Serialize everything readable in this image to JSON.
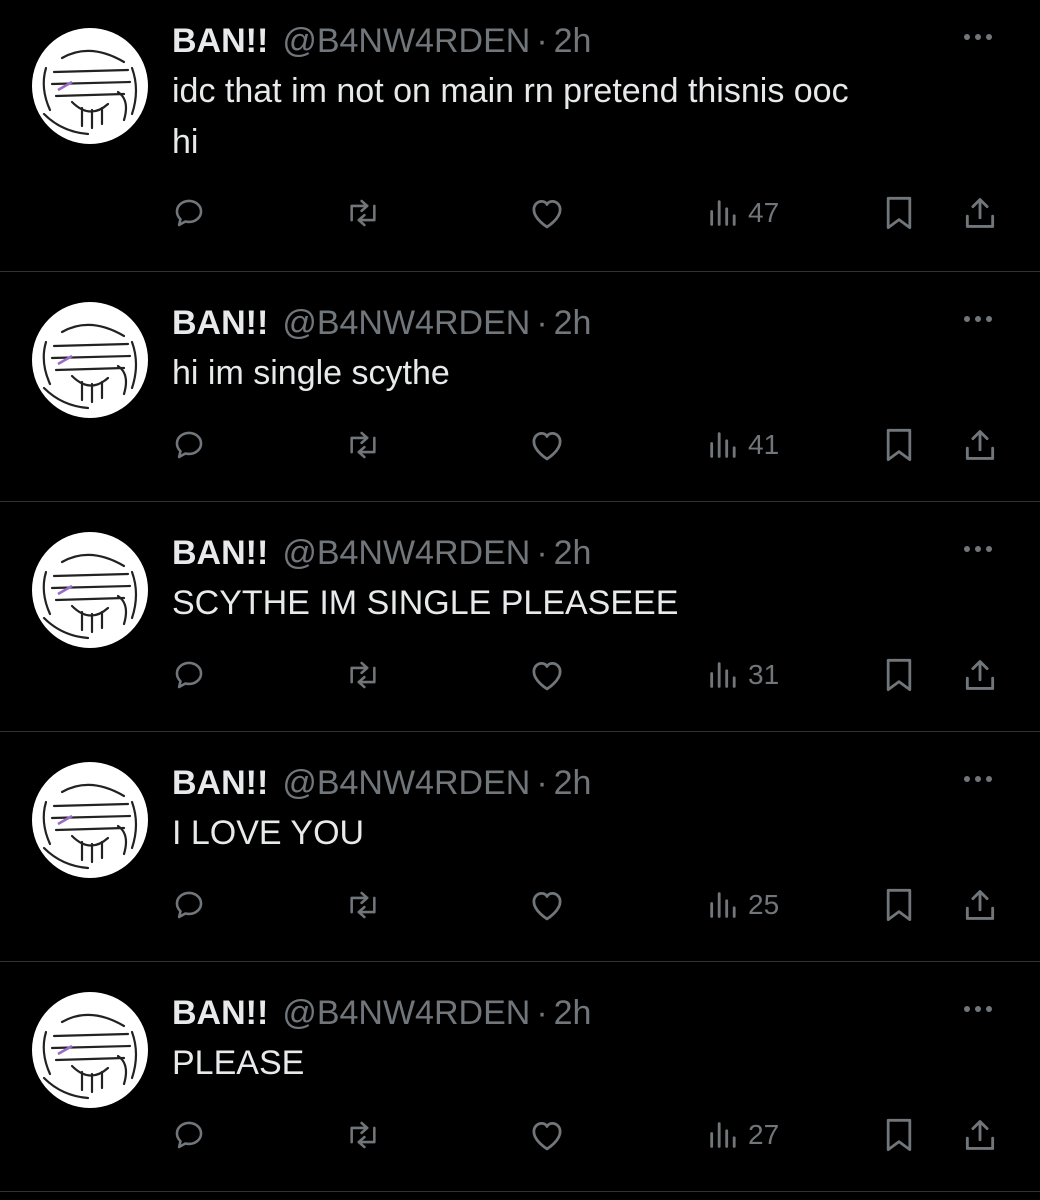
{
  "tweets": [
    {
      "name": "BAN!!",
      "handle": "@B4NW4RDEN",
      "separator": "·",
      "time": "2h",
      "text": "idc that im not on main rn pretend thisnis ooc\nhi",
      "views": "47"
    },
    {
      "name": "BAN!!",
      "handle": "@B4NW4RDEN",
      "separator": "·",
      "time": "2h",
      "text": "hi im single scythe",
      "views": "41"
    },
    {
      "name": "BAN!!",
      "handle": "@B4NW4RDEN",
      "separator": "·",
      "time": "2h",
      "text": "SCYTHE IM SINGLE PLEASEEE",
      "views": "31"
    },
    {
      "name": "BAN!!",
      "handle": "@B4NW4RDEN",
      "separator": "·",
      "time": "2h",
      "text": "I LOVE YOU",
      "views": "25"
    },
    {
      "name": "BAN!!",
      "handle": "@B4NW4RDEN",
      "separator": "·",
      "time": "2h",
      "text": "PLEASE",
      "views": "27"
    }
  ],
  "icons": {
    "reply": "reply-icon",
    "repost": "repost-icon",
    "like": "like-icon",
    "views": "views-icon",
    "bookmark": "bookmark-icon",
    "share": "share-icon",
    "more": "more-icon"
  },
  "colors": {
    "background": "#000000",
    "text": "#e7e9ea",
    "secondary": "#71767b",
    "divider": "#2f3336"
  }
}
